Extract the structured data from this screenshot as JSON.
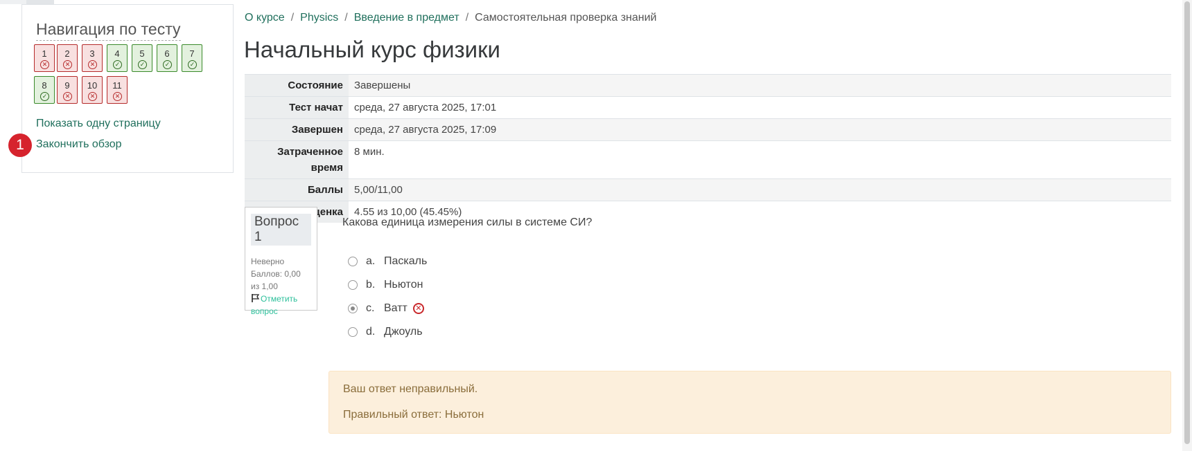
{
  "navigation": {
    "title": "Навигация по тесту",
    "questions": [
      {
        "num": "1",
        "status": "wrong"
      },
      {
        "num": "2",
        "status": "wrong"
      },
      {
        "num": "3",
        "status": "wrong"
      },
      {
        "num": "4",
        "status": "correct"
      },
      {
        "num": "5",
        "status": "correct"
      },
      {
        "num": "6",
        "status": "correct"
      },
      {
        "num": "7",
        "status": "correct"
      },
      {
        "num": "8",
        "status": "correct"
      },
      {
        "num": "9",
        "status": "wrong"
      },
      {
        "num": "10",
        "status": "wrong"
      },
      {
        "num": "11",
        "status": "wrong"
      }
    ],
    "show_one_page": "Показать одну страницу",
    "finish_review": "Закончить обзор",
    "badge": "1"
  },
  "breadcrumb": [
    "О курсе",
    "Physics",
    "Введение в предмет",
    "Самостоятельная проверка знаний"
  ],
  "page_title": "Начальный курс физики",
  "summary": {
    "state_label": "Состояние",
    "state_value": "Завершены",
    "started_label": "Тест начат",
    "started_value": "среда, 27 августа 2025, 17:01",
    "completed_label": "Завершен",
    "completed_value": "среда, 27 августа 2025, 17:09",
    "time_label": "Затраченное время",
    "time_value": "8 мин.",
    "marks_label": "Баллы",
    "marks_value": "5,00/11,00",
    "grade_label": "Оценка",
    "grade_value": "4.55 из 10,00 (45.45%)"
  },
  "question": {
    "number": "Вопрос 1",
    "state": "Неверно",
    "mark": "Баллов: 0,00 из 1,00",
    "flag": "Отметить вопрос",
    "text": "Какова единица измерения силы в системе СИ?",
    "answers": [
      {
        "letter": "a.",
        "text": "Паскаль",
        "checked": false
      },
      {
        "letter": "b.",
        "text": "Ньютон",
        "checked": false
      },
      {
        "letter": "c.",
        "text": "Ватт",
        "checked": true
      },
      {
        "letter": "d.",
        "text": "Джоуль",
        "checked": false
      }
    ]
  },
  "feedback": {
    "incorrect": "Ваш ответ неправильный.",
    "right_answer": "Правильный ответ: Ньютон"
  },
  "colors": {
    "link": "#1f6f5c",
    "wrong": "#b52a2a",
    "correct": "#3a8a2a",
    "feedback_bg": "#fcefdc",
    "badge": "#d6232d"
  }
}
